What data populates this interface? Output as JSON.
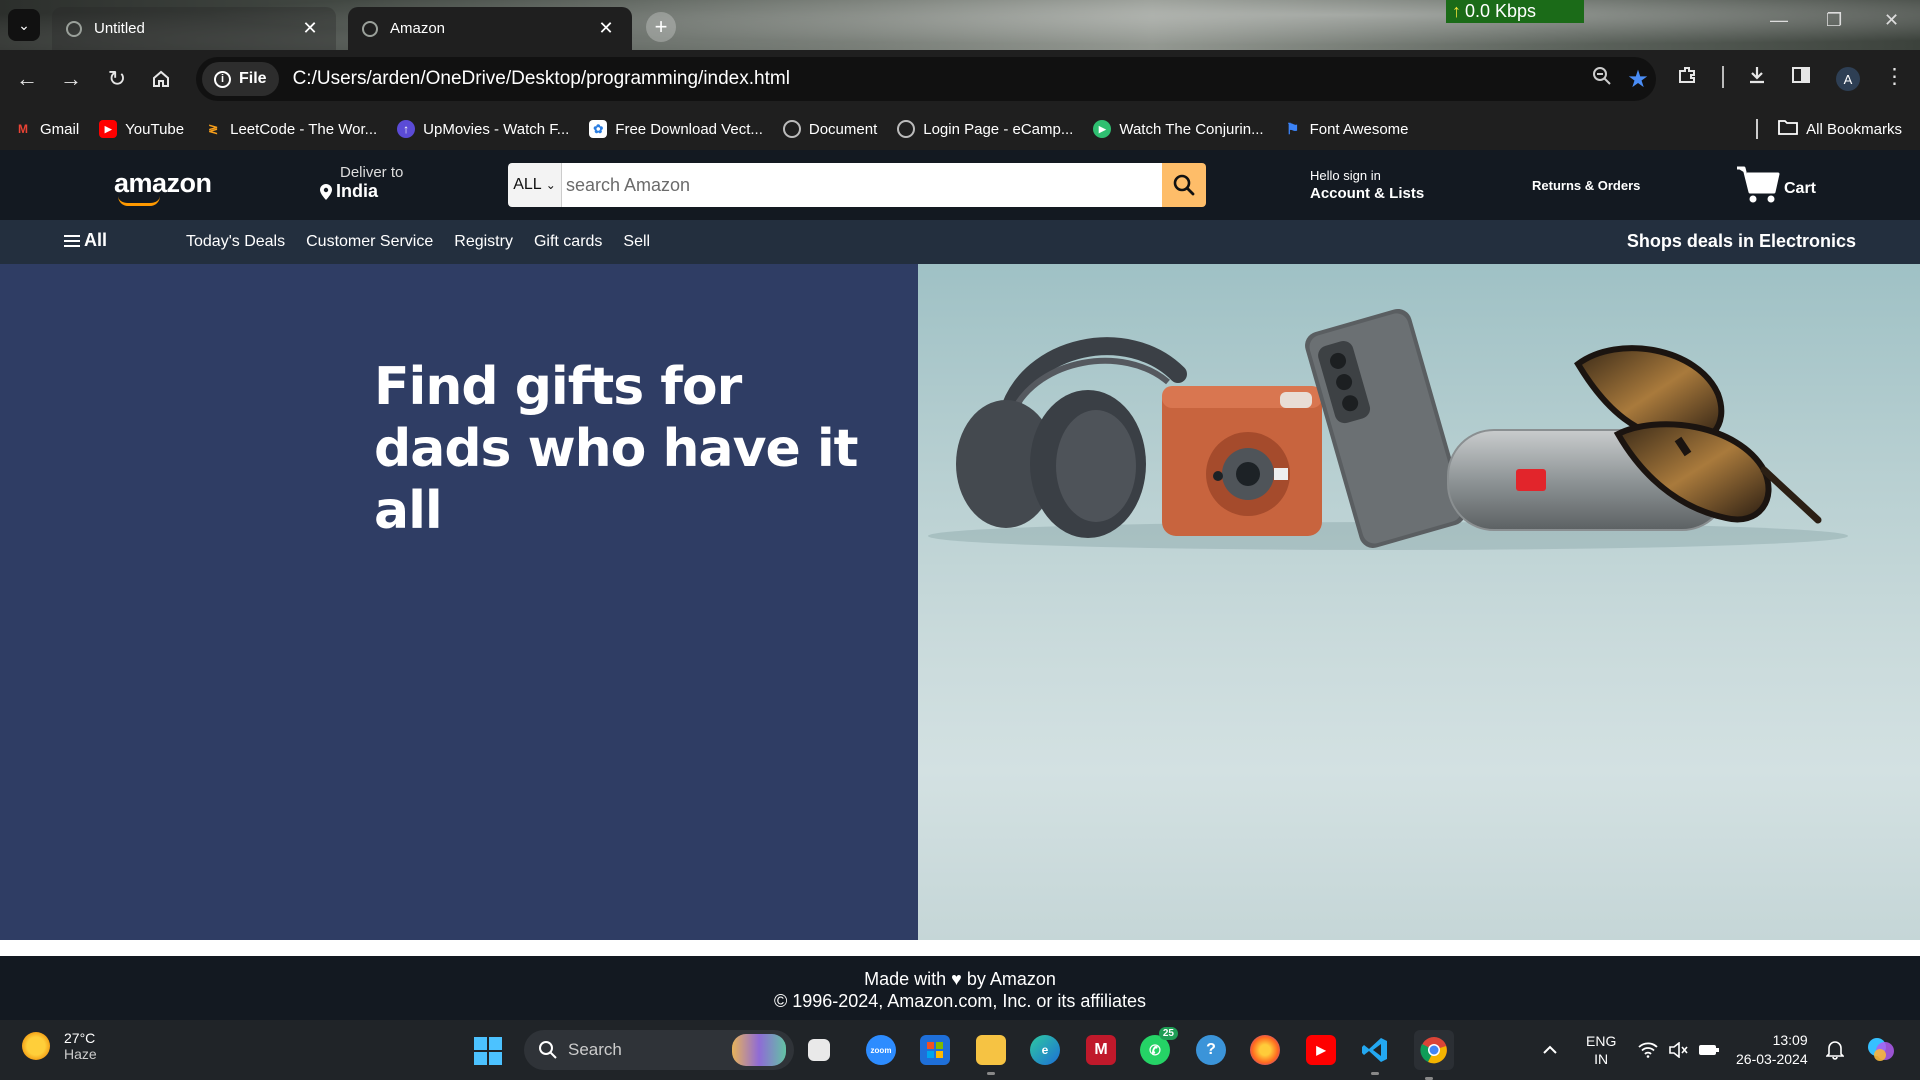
{
  "browser": {
    "tabs": [
      {
        "title": "Untitled",
        "close": "✕"
      },
      {
        "title": "Amazon",
        "close": "✕"
      }
    ],
    "new_tab": "+",
    "net_speed": "0.0 Kbps",
    "address": {
      "scheme_chip": "File",
      "url": "C:/Users/arden/OneDrive/Desktop/programming/index.html"
    },
    "profile_initial": "A",
    "bookmarks": [
      {
        "label": "Gmail",
        "icon": "gmail-icon",
        "color": "#ea4335"
      },
      {
        "label": "YouTube",
        "icon": "youtube-icon",
        "color": "#ff0000"
      },
      {
        "label": "LeetCode - The Wor...",
        "icon": "leetcode-icon",
        "color": "#f89f1b"
      },
      {
        "label": "UpMovies - Watch F...",
        "icon": "upmovies-icon",
        "color": "#5b4bd6"
      },
      {
        "label": "Free Download Vect...",
        "icon": "freepik-icon",
        "color": "#2a7de1"
      },
      {
        "label": "Document",
        "icon": "globe-icon",
        "color": "#bbbbbb"
      },
      {
        "label": "Login Page - eCamp...",
        "icon": "globe-icon",
        "color": "#bbbbbb"
      },
      {
        "label": "Watch The Conjurin...",
        "icon": "play-icon",
        "color": "#2fbf71"
      },
      {
        "label": "Font Awesome",
        "icon": "flag-icon",
        "color": "#3b82f6"
      }
    ],
    "all_bookmarks": "All Bookmarks"
  },
  "amazon": {
    "logo": "amazon",
    "deliver_to": "Deliver to",
    "location": "India",
    "search_category": "ALL",
    "search_placeholder": "search Amazon",
    "greeting": "Hello sign in",
    "account_lists": "Account & Lists",
    "returns_orders": "Returns & Orders",
    "cart": "Cart",
    "nav_all": "All",
    "nav_links": [
      "Today's Deals",
      "Customer Service",
      "Registry",
      "Gift cards",
      "Sell"
    ],
    "nav_deal": "Shops deals in Electronics",
    "hero_line1": "Find gifts for",
    "hero_line2": "dads who have it all",
    "footer_line1": "Made with ♥ by Amazon",
    "footer_line2": "© 1996-2024, Amazon.com, Inc. or its affiliates",
    "colors": {
      "header": "#131921",
      "nav": "#232f3e",
      "hero_left": "#2f3d64",
      "search_btn": "#febd69",
      "accent": "#ff9900"
    }
  },
  "taskbar": {
    "temp": "27°C",
    "condition": "Haze",
    "search": "Search",
    "whatsapp_badge": "25",
    "lang": "ENG",
    "region": "IN",
    "time": "13:09",
    "date": "26-03-2024"
  }
}
